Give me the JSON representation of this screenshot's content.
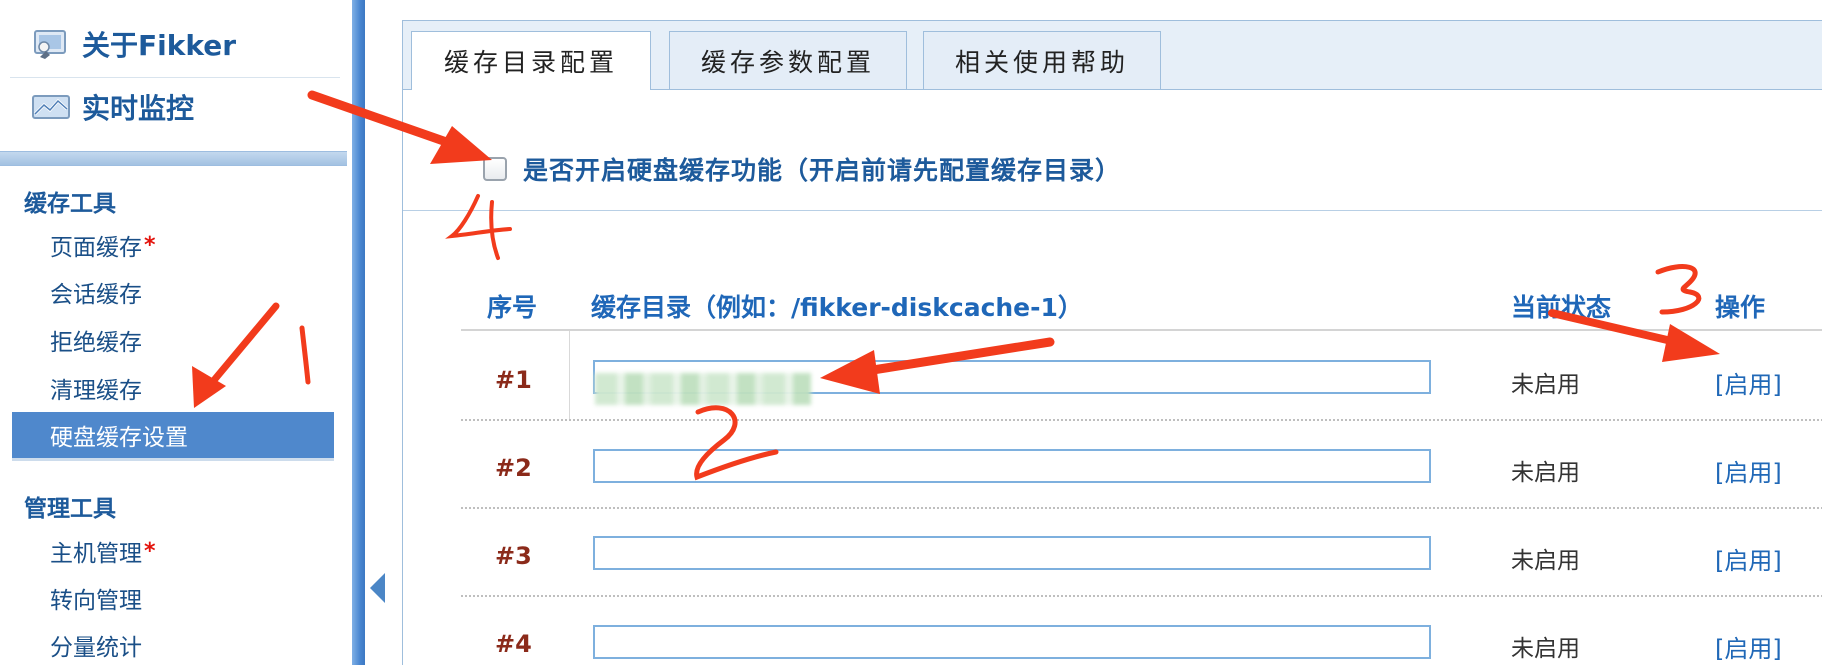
{
  "sidebar": {
    "top_links": [
      {
        "label": "关于Fikker",
        "icon": "about-icon"
      },
      {
        "label": "实时监控",
        "icon": "monitor-icon"
      }
    ],
    "groups": [
      {
        "title": "缓存工具",
        "items": [
          {
            "label": "页面缓存",
            "star": "*"
          },
          {
            "label": "会话缓存",
            "star": ""
          },
          {
            "label": "拒绝缓存",
            "star": ""
          },
          {
            "label": "清理缓存",
            "star": ""
          },
          {
            "label": "硬盘缓存设置",
            "star": "",
            "active": true
          }
        ]
      },
      {
        "title": "管理工具",
        "items": [
          {
            "label": "主机管理",
            "star": "*"
          },
          {
            "label": "转向管理",
            "star": ""
          },
          {
            "label": "分量统计",
            "star": ""
          }
        ]
      }
    ]
  },
  "tabs": [
    {
      "label": "缓存目录配置",
      "active": true
    },
    {
      "label": "缓存参数配置",
      "active": false
    },
    {
      "label": "相关使用帮助",
      "active": false
    }
  ],
  "enable_option": {
    "label": "是否开启硬盘缓存功能（开启前请先配置缓存目录）",
    "checked": false
  },
  "table": {
    "headers": {
      "index": "序号",
      "dir": "缓存目录（例如：/fikker-diskcache-1）",
      "status": "当前状态",
      "action": "操作"
    },
    "rows": [
      {
        "index": "#1",
        "value": "",
        "status": "未启用",
        "action": "[启用]"
      },
      {
        "index": "#2",
        "value": "",
        "status": "未启用",
        "action": "[启用]"
      },
      {
        "index": "#3",
        "value": "",
        "status": "未启用",
        "action": "[启用]"
      },
      {
        "index": "#4",
        "value": "",
        "status": "未启用",
        "action": "[启用]"
      }
    ]
  },
  "annotations": {
    "labels": [
      "1",
      "2",
      "3",
      "4"
    ],
    "color": "#f23b1c"
  }
}
